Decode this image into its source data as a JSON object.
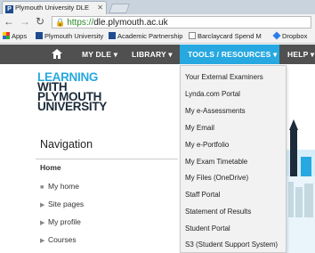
{
  "browser": {
    "tab_title": "Plymouth University DLE",
    "url_scheme": "https://",
    "url_host": "dle.plymouth.ac.uk",
    "bookmarks": [
      "Apps",
      "Plymouth University",
      "Academic Partnership",
      "Barclaycard Spend M",
      "Dropbox"
    ]
  },
  "sitenav": {
    "items": [
      "MY DLE ▾",
      "LIBRARY ▾",
      "TOOLS / RESOURCES ▾",
      "HELP ▾"
    ]
  },
  "logo": {
    "line1": "LEARNING",
    "line2": "WITH",
    "line3": "PLYMOUTH",
    "line4": "UNIVERSITY"
  },
  "navigation": {
    "title": "Navigation",
    "home": "Home",
    "items": [
      "My home",
      "Site pages",
      "My profile",
      "Courses"
    ]
  },
  "dropdown": {
    "items": [
      "Your External Examiners",
      "Lynda.com Portal",
      "My e-Assessments",
      "My Email",
      "My e-Portfolio",
      "My Exam Timetable",
      "My Files (OneDrive)",
      "Staff Portal",
      "Statement of Results",
      "Student Portal",
      "S3 (Student Support System)"
    ]
  },
  "colors": {
    "accent": "#27a8e0",
    "navbar": "#505050",
    "logo_dark": "#1d2b3a"
  }
}
